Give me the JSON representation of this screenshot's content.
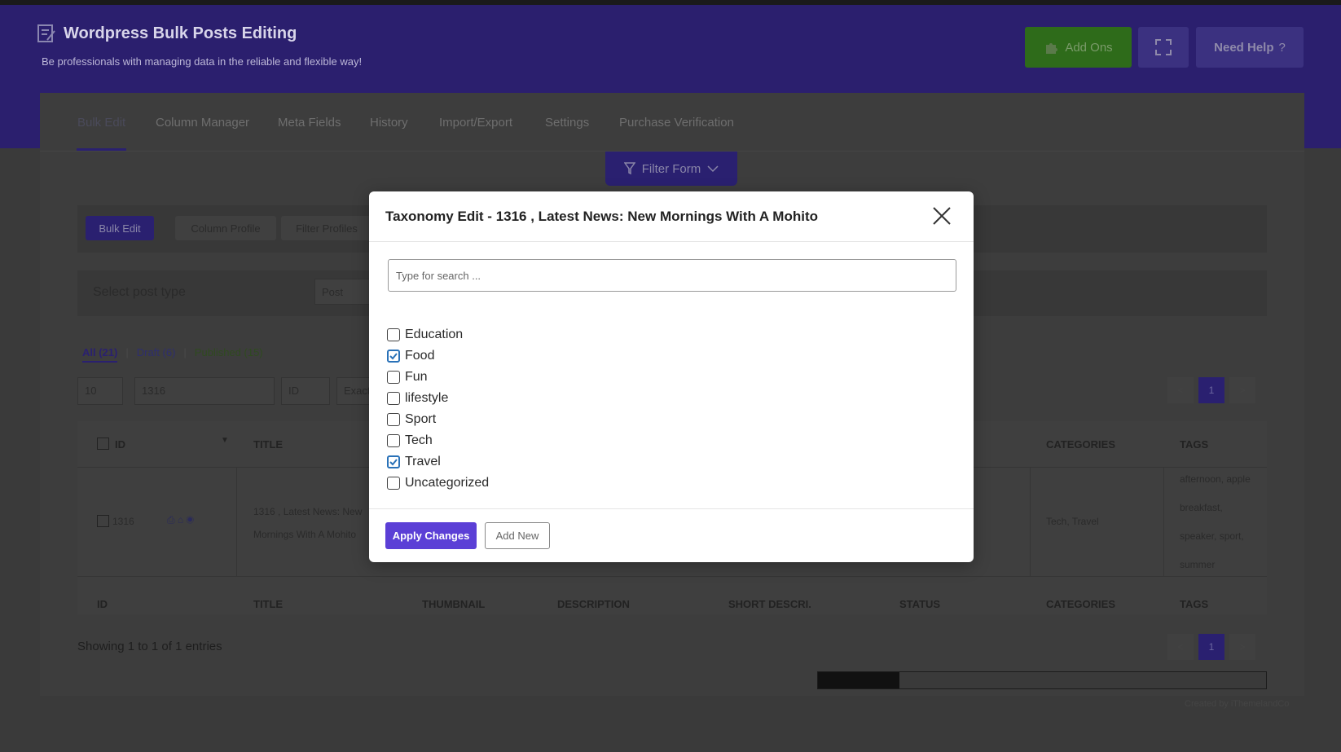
{
  "app": {
    "title": "Wordpress Bulk Posts Editing",
    "subtitle": "Be professionals with managing data in the reliable and flexible way!",
    "buttons": {
      "add_ons": "Add Ons",
      "need_help": "Need Help",
      "help_suffix": "?"
    }
  },
  "tabs": [
    "Bulk Edit",
    "Column Manager",
    "Meta Fields",
    "History",
    "Import/Export",
    "Settings",
    "Purchase Verification"
  ],
  "filter_form_label": "Filter Form",
  "toolbar": {
    "bulk_edit": "Bulk Edit",
    "column_profile": "Column Profile",
    "filter_profiles": "Filter Profiles"
  },
  "post_type": {
    "label": "Select post type",
    "value": "Post"
  },
  "status_links": {
    "all": "All (21)",
    "draft": "Draft (6)",
    "published": "Published (15)",
    "sep": "|"
  },
  "controls": {
    "per_page": "10",
    "search_value": "1316",
    "field": "ID",
    "match": "Exact"
  },
  "pagination": {
    "prev": "<",
    "current": "1",
    "next": ">"
  },
  "table": {
    "headers_top": {
      "id": "ID",
      "title": "TITLE",
      "categories": "CATEGORIES",
      "tags": "TAGS"
    },
    "headers_bottom": [
      "ID",
      "TITLE",
      "THUMBNAIL",
      "DESCRIPTION",
      "SHORT DESCRI.",
      "STATUS",
      "CATEGORIES",
      "TAGS"
    ],
    "row": {
      "id": "1316",
      "title_line1": "1316 , Latest News: New",
      "title_line2": "Mornings With A Mohito",
      "categories": "Tech, Travel",
      "tags": [
        "afternoon, apple",
        "breakfast,",
        "speaker, sport,",
        "summer"
      ]
    }
  },
  "showing": "Showing 1 to 1 of 1 entries",
  "credit": "Created by iThemelandCo",
  "modal": {
    "title": "Taxonomy Edit - 1316 , Latest News: New Mornings With A Mohito",
    "search_placeholder": "Type for search ...",
    "terms": [
      {
        "label": "Education",
        "checked": false
      },
      {
        "label": "Food",
        "checked": true
      },
      {
        "label": "Fun",
        "checked": false
      },
      {
        "label": "lifestyle",
        "checked": false
      },
      {
        "label": "Sport",
        "checked": false
      },
      {
        "label": "Tech",
        "checked": false
      },
      {
        "label": "Travel",
        "checked": true
      },
      {
        "label": "Uncategorized",
        "checked": false
      }
    ],
    "apply_label": "Apply Changes",
    "add_new_label": "Add New"
  }
}
